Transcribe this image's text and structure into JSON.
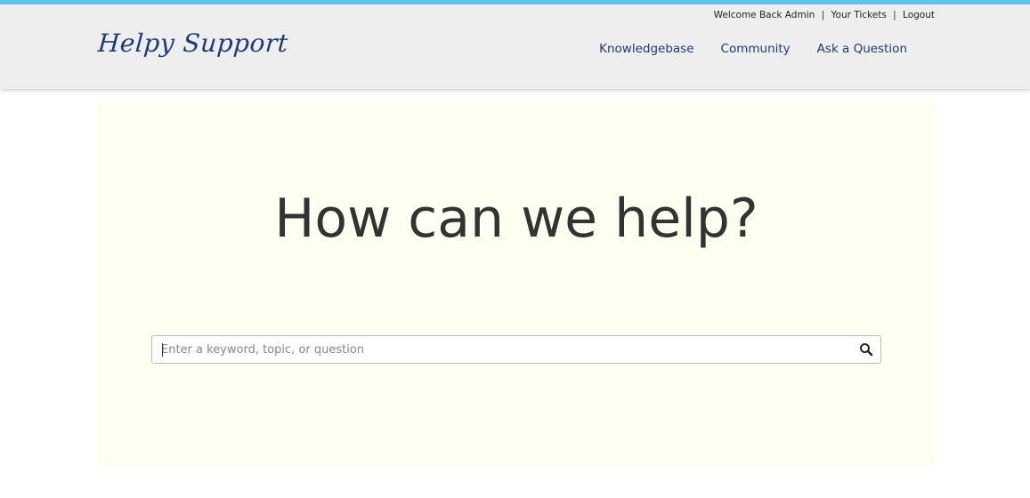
{
  "header": {
    "logo_text": "Helpy Support",
    "utility": {
      "welcome": "Welcome Back Admin",
      "separator": "|",
      "tickets": "Your Tickets",
      "logout": "Logout"
    },
    "nav": {
      "knowledgebase": "Knowledgebase",
      "community": "Community",
      "ask": "Ask a Question"
    }
  },
  "hero": {
    "title": "How can we help?",
    "search": {
      "placeholder": "Enter a keyword, topic, or question",
      "value": "",
      "icon": "search-icon"
    }
  },
  "colors": {
    "top_stripe": "#5ec4ee",
    "header_bg": "#eeeeee",
    "brand": "#1d3a7a",
    "hero_bg": "#fefff0",
    "title_text": "#333333"
  }
}
